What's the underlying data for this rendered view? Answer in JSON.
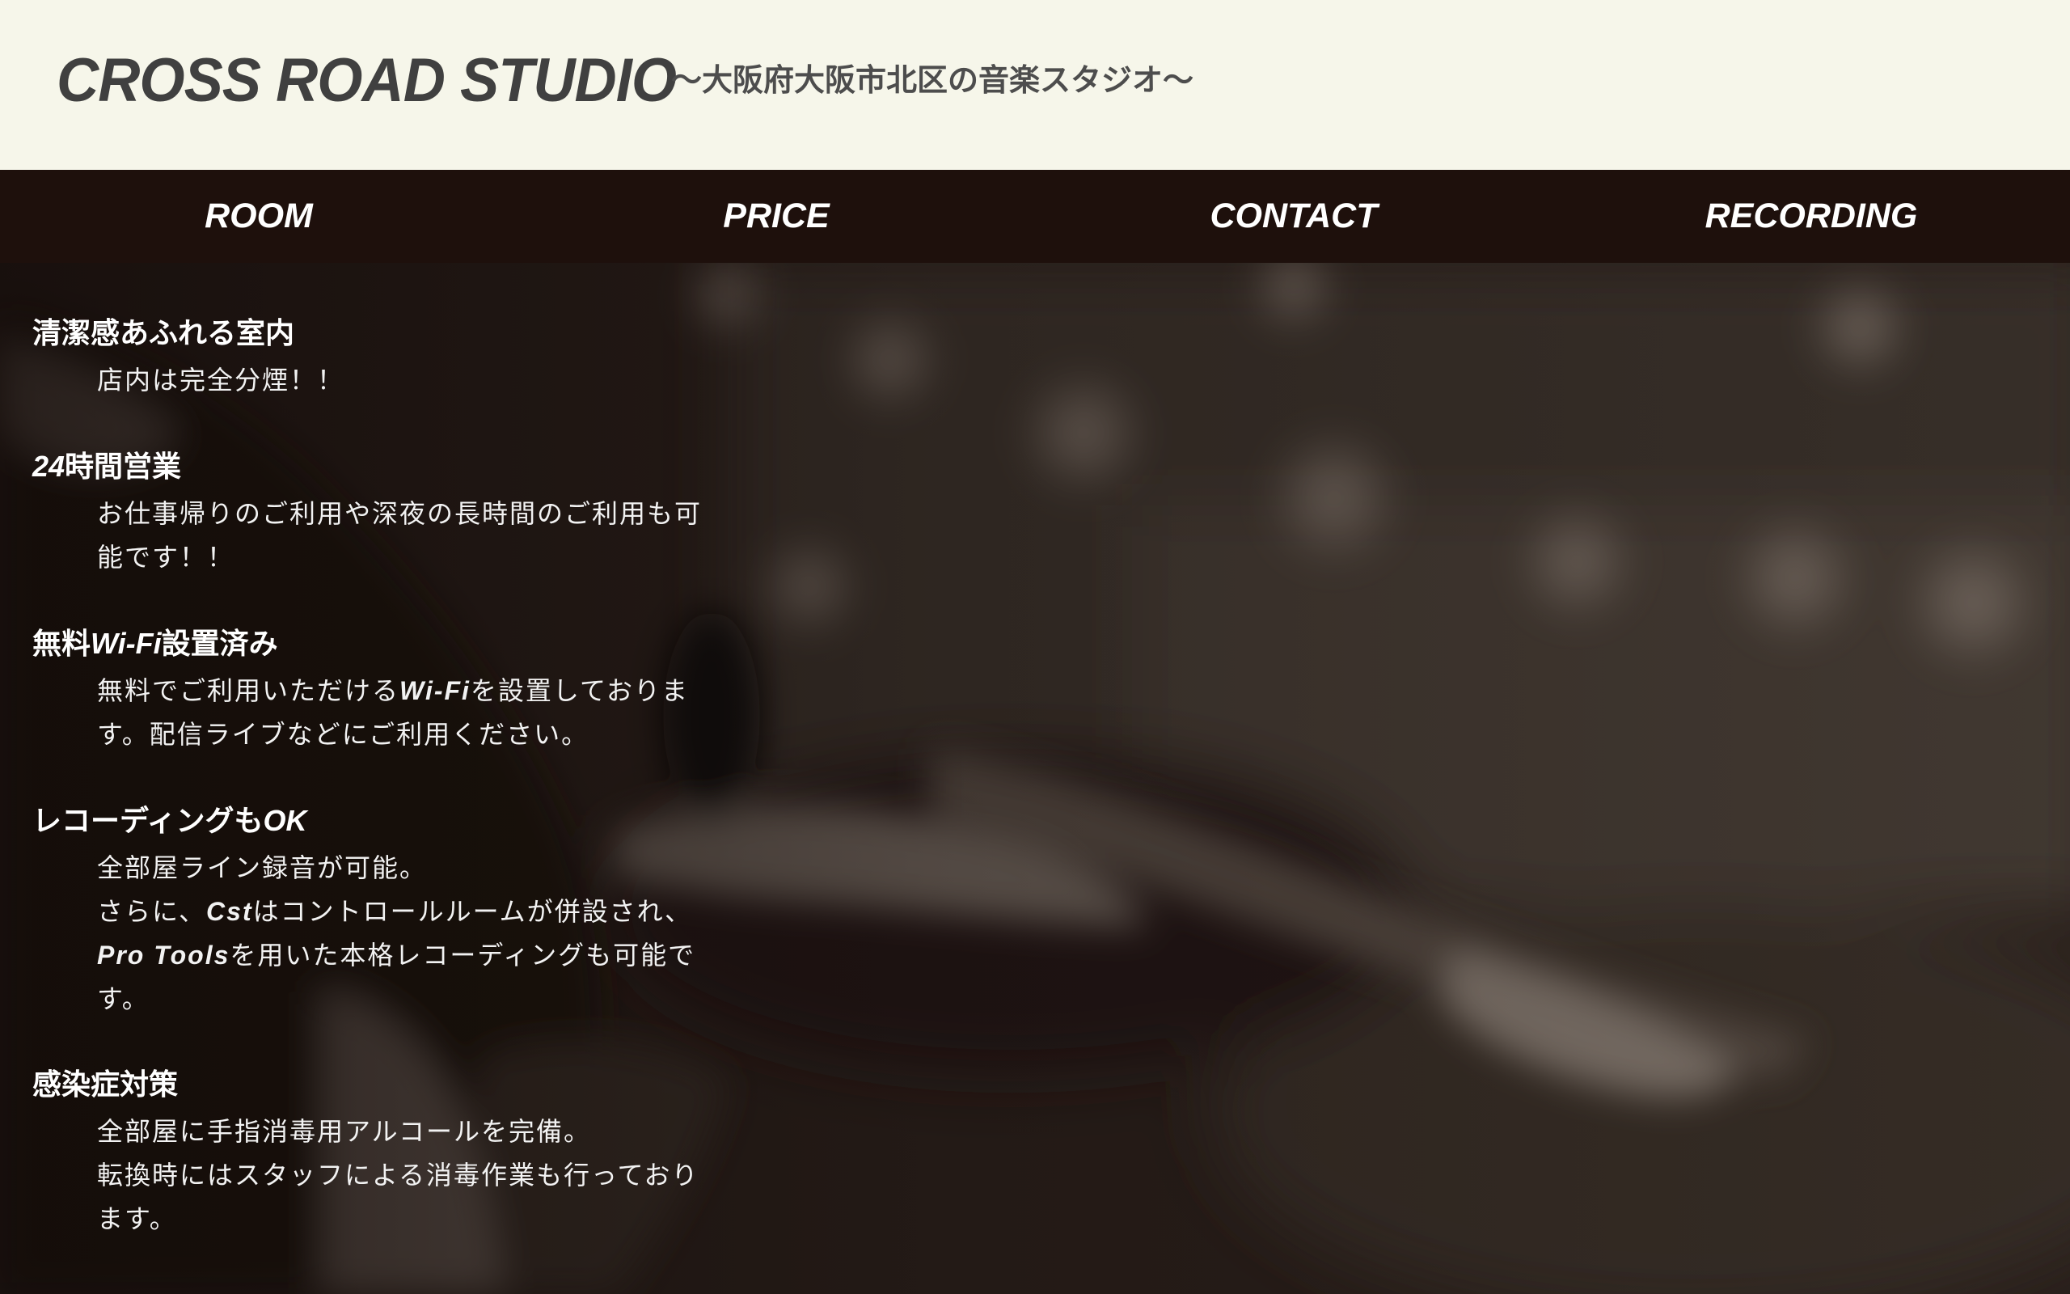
{
  "header": {
    "logo": "CROSS ROAD STUDIO",
    "tagline": "〜大阪府大阪市北区の音楽スタジオ〜"
  },
  "nav": {
    "items": [
      {
        "label": "ROOM"
      },
      {
        "label": "PRICE"
      },
      {
        "label": "CONTACT"
      },
      {
        "label": "RECORDING"
      }
    ]
  },
  "features": [
    {
      "title": "清潔感あふれる室内",
      "lines": [
        "店内は完全分煙！！"
      ]
    },
    {
      "title_latin": "24",
      "title_rest": "時間営業",
      "lines": [
        "お仕事帰りのご利用や深夜の長時間のご利用も可",
        "能です！！"
      ]
    },
    {
      "title_pre": "無料",
      "title_latin": "Wi-Fi",
      "title_post": "設置済み",
      "line1_pre": "無料でご利用いただける",
      "line1_latin": "Wi-Fi",
      "line1_post": "を設置しておりま",
      "line2": "す。配信ライブなどにご利用ください。"
    },
    {
      "title_pre": "レコーディングも",
      "title_latin": "OK",
      "line1": "全部屋ライン録音が可能。",
      "line2_pre": "さらに、",
      "line2_latin": "Cst",
      "line2_post": "はコントロールルームが併設され、",
      "line3_latin": "Pro Tools",
      "line3_post": "を用いた本格レコーディングも可能で",
      "line4": "す。"
    },
    {
      "title": "感染症対策",
      "lines": [
        "全部屋に手指消毒用アルコールを完備。",
        "転換時にはスタッフによる消毒作業も行っており",
        "ます。"
      ]
    }
  ],
  "colors": {
    "header_bg": "#f6f6ea",
    "logo_text": "#404040",
    "nav_bg": "#1e100c",
    "nav_text": "#ffffff",
    "body_text": "#ffffff"
  }
}
